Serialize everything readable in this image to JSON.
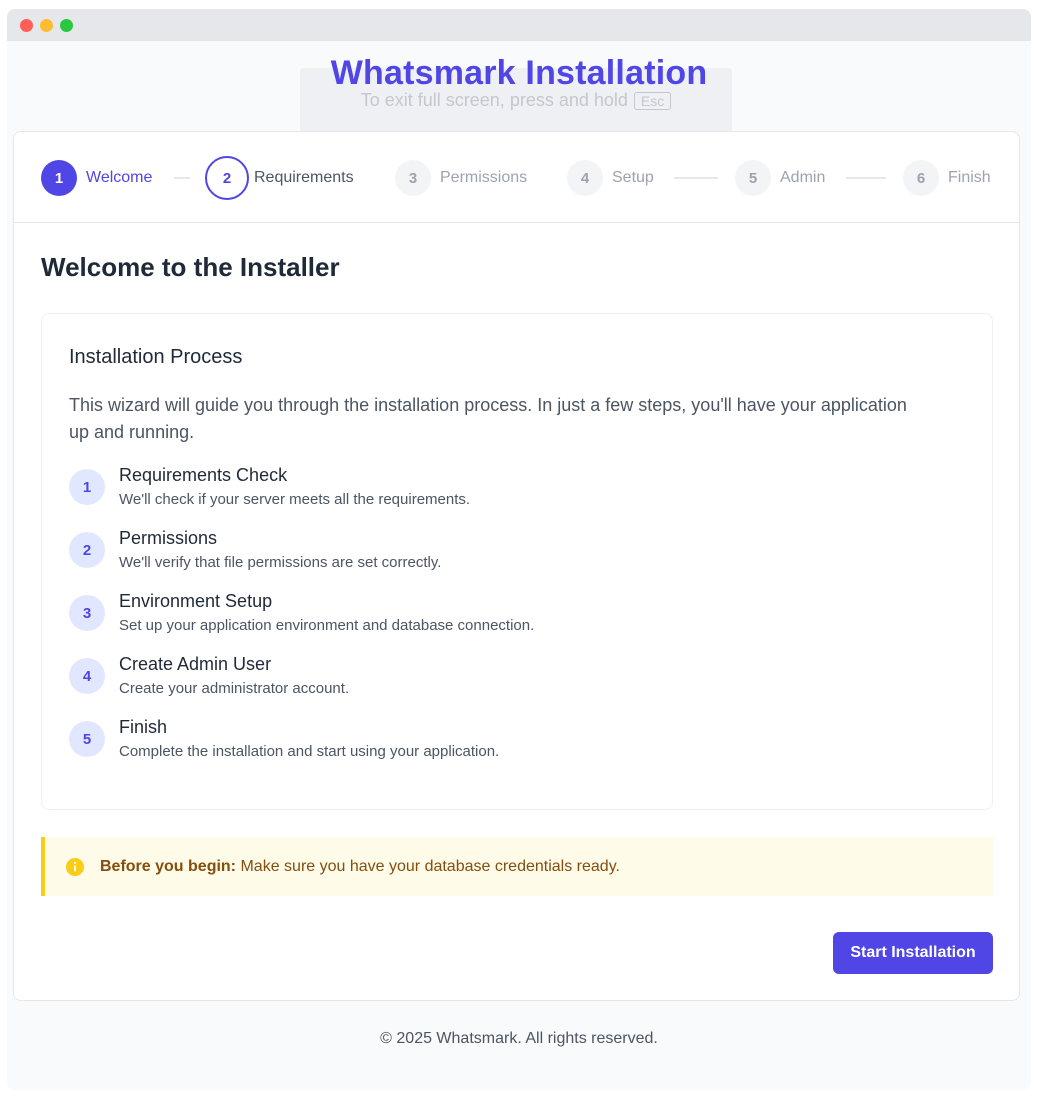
{
  "app_title": "Whatsmark Installation",
  "fullscreen_hint": {
    "text": "To exit full screen, press and hold",
    "key": "Esc"
  },
  "stepper": {
    "steps": [
      {
        "number": "1",
        "label": "Welcome"
      },
      {
        "number": "2",
        "label": "Requirements"
      },
      {
        "number": "3",
        "label": "Permissions"
      },
      {
        "number": "4",
        "label": "Setup"
      },
      {
        "number": "5",
        "label": "Admin"
      },
      {
        "number": "6",
        "label": "Finish"
      }
    ]
  },
  "main": {
    "heading": "Welcome to the Installer",
    "process": {
      "title": "Installation Process",
      "intro": "This wizard will guide you through the installation process. In just a few steps, you'll have your application up and running.",
      "items": [
        {
          "number": "1",
          "title": "Requirements Check",
          "desc": "We'll check if your server meets all the requirements."
        },
        {
          "number": "2",
          "title": "Permissions",
          "desc": "We'll verify that file permissions are set correctly."
        },
        {
          "number": "3",
          "title": "Environment Setup",
          "desc": "Set up your application environment and database connection."
        },
        {
          "number": "4",
          "title": "Create Admin User",
          "desc": "Create your administrator account."
        },
        {
          "number": "5",
          "title": "Finish",
          "desc": "Complete the installation and start using your application."
        }
      ]
    },
    "notice": {
      "label": "Before you begin:",
      "text": "Make sure you have your database credentials ready.",
      "icon": "info-icon"
    },
    "start_button": "Start Installation"
  },
  "footer": "© 2025 Whatsmark. All rights reserved.",
  "colors": {
    "accent": "#4f46e5",
    "notice_bg": "#fefce8",
    "notice_border": "#facc15",
    "notice_text": "#854d0e"
  }
}
